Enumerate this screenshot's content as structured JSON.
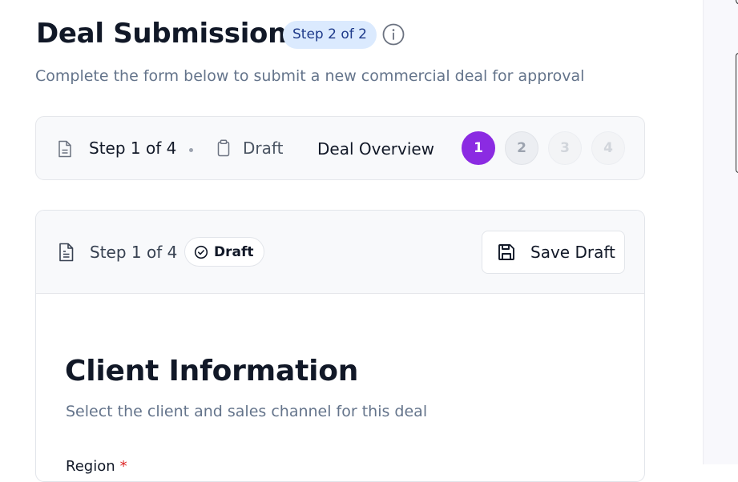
{
  "header": {
    "title": "Deal Submission",
    "step_pill": "Step 2 of 2",
    "subtitle": "Complete the form below to submit a new commercial deal for approval"
  },
  "stepper": {
    "step_text": "Step 1 of 4",
    "status": "Draft",
    "section": "Deal Overview",
    "steps": [
      "1",
      "2",
      "3",
      "4"
    ],
    "active_step": 1
  },
  "card": {
    "step_text": "Step 1 of 4",
    "status_badge": "Draft",
    "save_label": "Save Draft",
    "section_title": "Client Information",
    "section_description": "Select the client and sales channel for this deal",
    "first_field_label": "Region",
    "required_marker": "*"
  },
  "colors": {
    "accent": "#8b2be2",
    "pill_bg": "#dbeafe",
    "pill_text": "#1e3a8a",
    "required": "#dc2626"
  },
  "icons": {
    "info": "info-icon",
    "document": "file-text-icon",
    "clipboard": "clipboard-icon",
    "check_circle": "check-circle-icon",
    "save": "save-icon"
  }
}
